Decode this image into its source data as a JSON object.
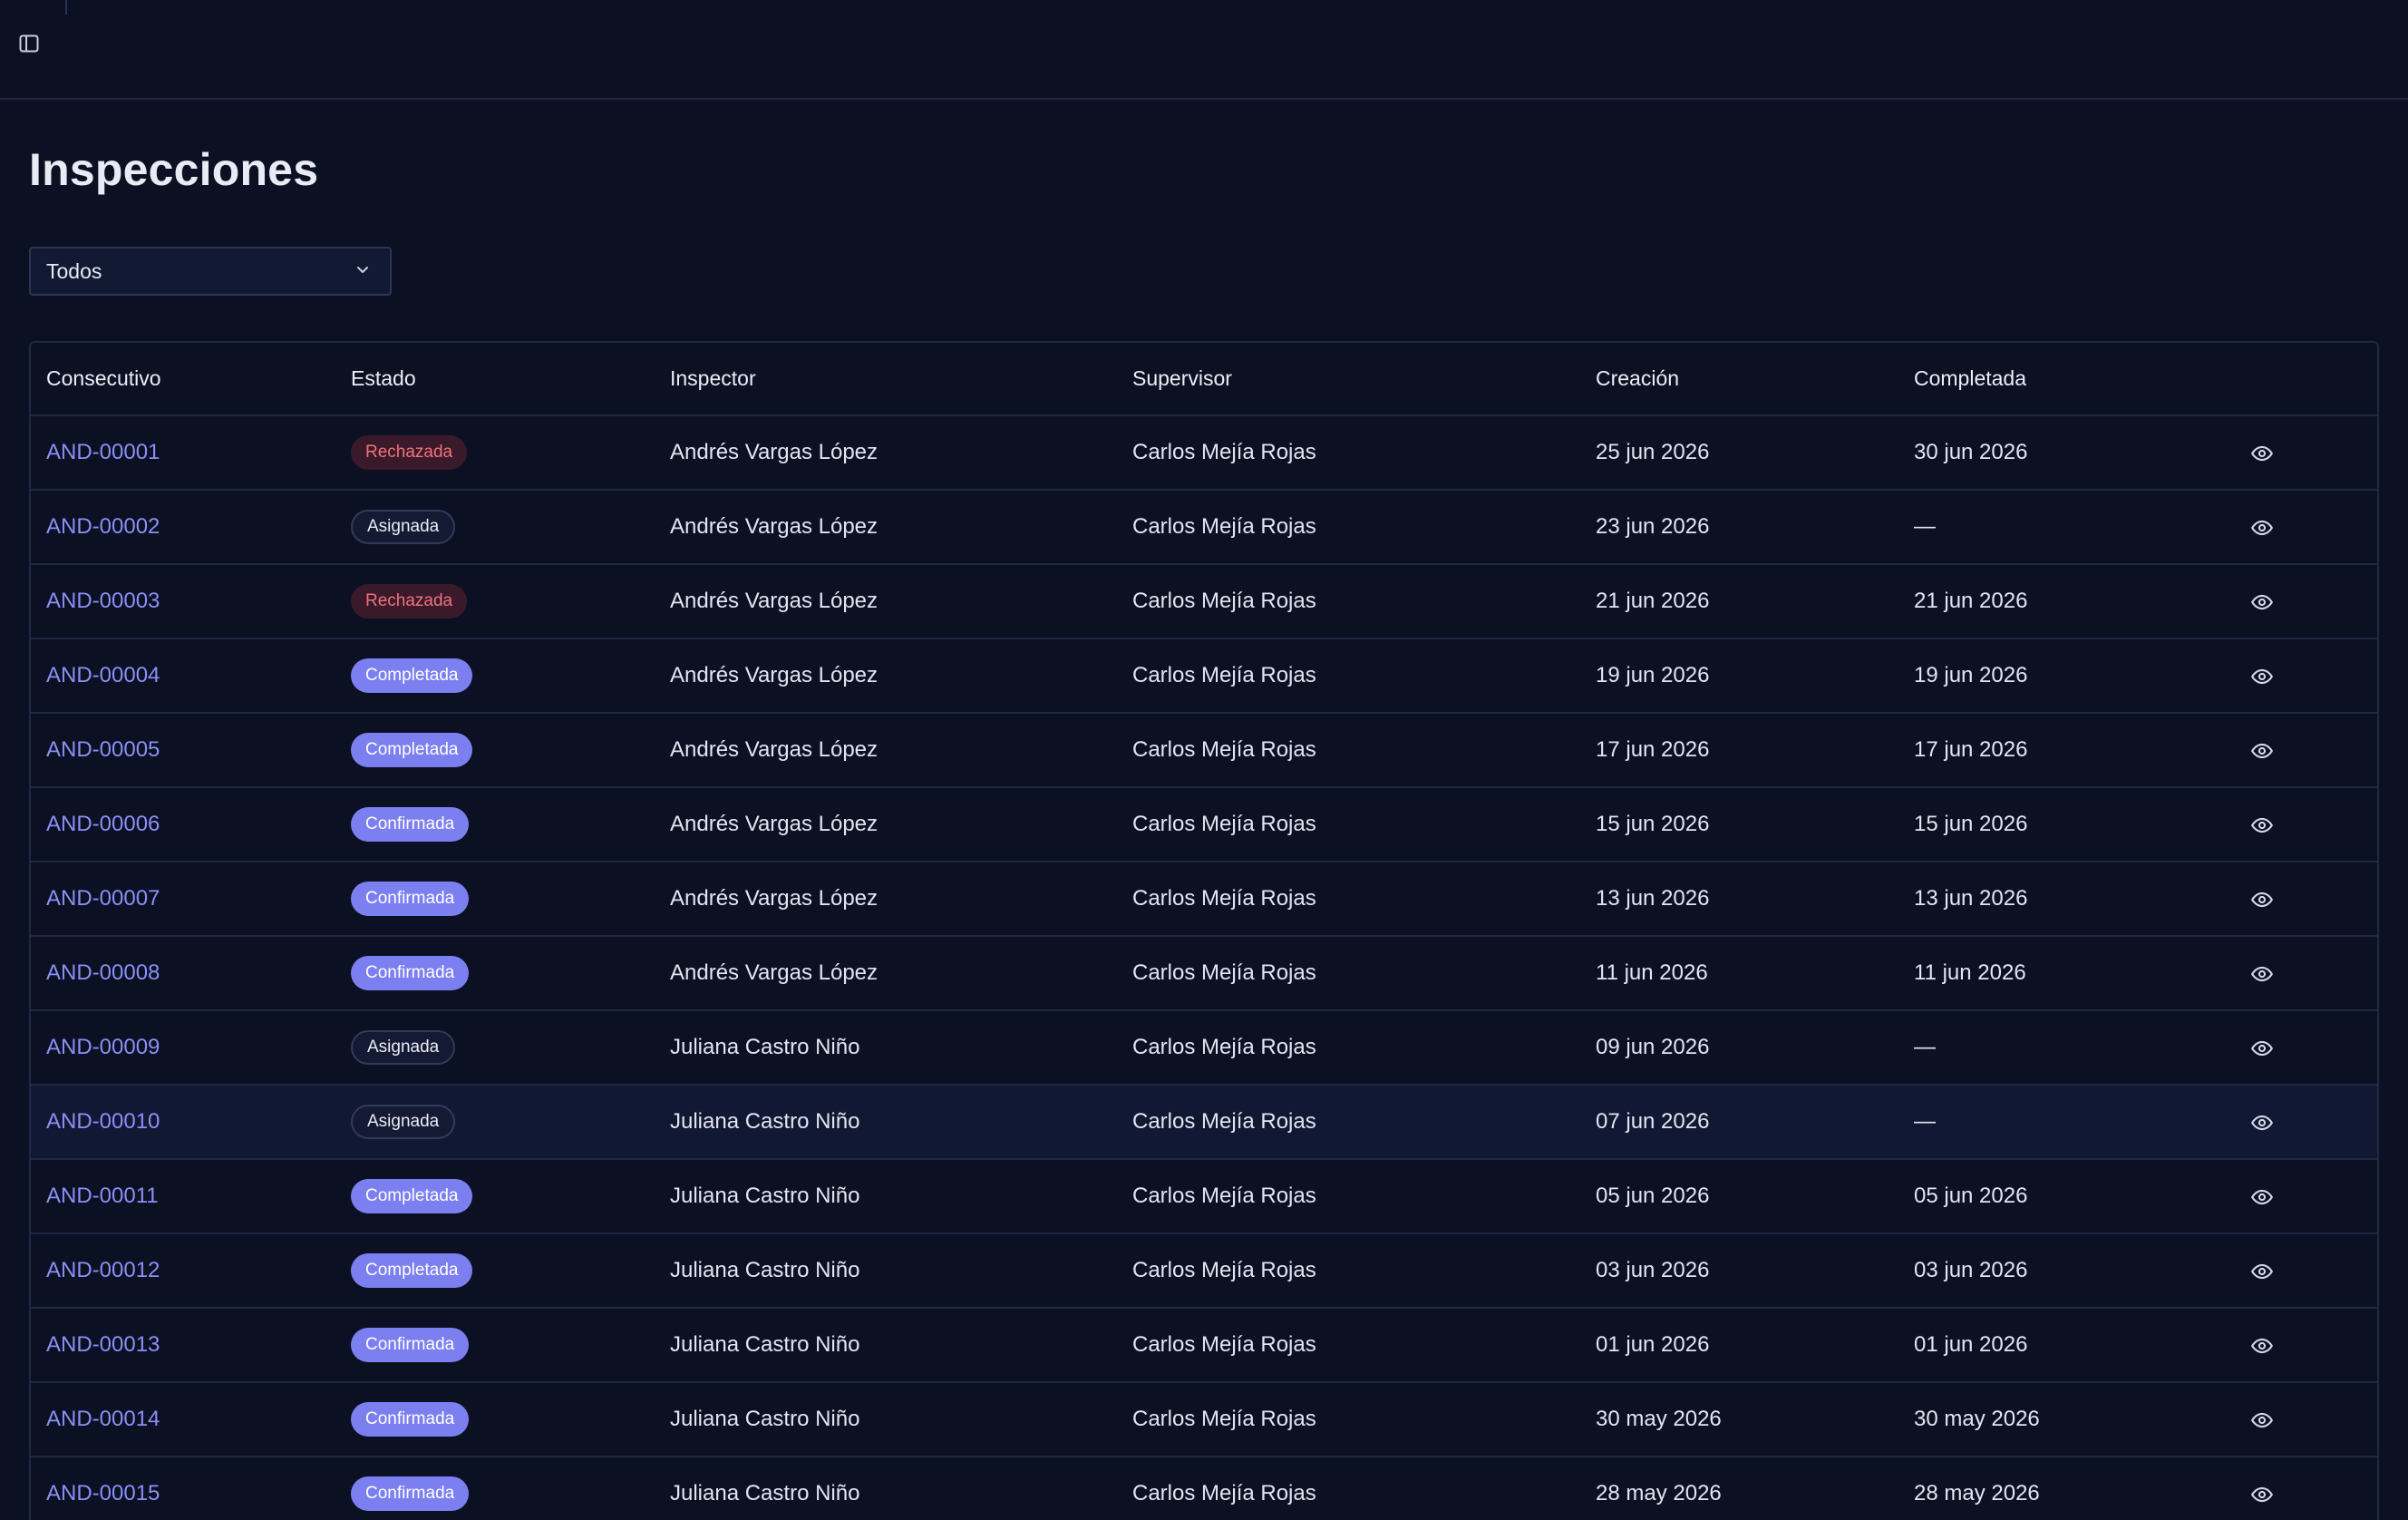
{
  "header": {
    "toggle_icon": "sidebar-toggle-icon"
  },
  "page": {
    "title": "Inspecciones"
  },
  "filter": {
    "selected": "Todos",
    "icon": "chevron-down-icon"
  },
  "table": {
    "columns": [
      "Consecutivo",
      "Estado",
      "Inspector",
      "Supervisor",
      "Creación",
      "Completada"
    ],
    "action_icon": "eye-icon",
    "rows": [
      {
        "code": "AND-00001",
        "status": "Rechazada",
        "status_key": "rechazada",
        "inspector": "Andrés Vargas López",
        "supervisor": "Carlos Mejía Rojas",
        "created": "25 jun 2026",
        "completed": "30 jun 2026"
      },
      {
        "code": "AND-00002",
        "status": "Asignada",
        "status_key": "asignada",
        "inspector": "Andrés Vargas López",
        "supervisor": "Carlos Mejía Rojas",
        "created": "23 jun 2026",
        "completed": "—"
      },
      {
        "code": "AND-00003",
        "status": "Rechazada",
        "status_key": "rechazada",
        "inspector": "Andrés Vargas López",
        "supervisor": "Carlos Mejía Rojas",
        "created": "21 jun 2026",
        "completed": "21 jun 2026"
      },
      {
        "code": "AND-00004",
        "status": "Completada",
        "status_key": "completada",
        "inspector": "Andrés Vargas López",
        "supervisor": "Carlos Mejía Rojas",
        "created": "19 jun 2026",
        "completed": "19 jun 2026"
      },
      {
        "code": "AND-00005",
        "status": "Completada",
        "status_key": "completada",
        "inspector": "Andrés Vargas López",
        "supervisor": "Carlos Mejía Rojas",
        "created": "17 jun 2026",
        "completed": "17 jun 2026"
      },
      {
        "code": "AND-00006",
        "status": "Confirmada",
        "status_key": "confirmada",
        "inspector": "Andrés Vargas López",
        "supervisor": "Carlos Mejía Rojas",
        "created": "15 jun 2026",
        "completed": "15 jun 2026"
      },
      {
        "code": "AND-00007",
        "status": "Confirmada",
        "status_key": "confirmada",
        "inspector": "Andrés Vargas López",
        "supervisor": "Carlos Mejía Rojas",
        "created": "13 jun 2026",
        "completed": "13 jun 2026"
      },
      {
        "code": "AND-00008",
        "status": "Confirmada",
        "status_key": "confirmada",
        "inspector": "Andrés Vargas López",
        "supervisor": "Carlos Mejía Rojas",
        "created": "11 jun 2026",
        "completed": "11 jun 2026"
      },
      {
        "code": "AND-00009",
        "status": "Asignada",
        "status_key": "asignada",
        "inspector": "Juliana Castro Niño",
        "supervisor": "Carlos Mejía Rojas",
        "created": "09 jun 2026",
        "completed": "—"
      },
      {
        "code": "AND-00010",
        "status": "Asignada",
        "status_key": "asignada",
        "inspector": "Juliana Castro Niño",
        "supervisor": "Carlos Mejía Rojas",
        "created": "07 jun 2026",
        "completed": "—"
      },
      {
        "code": "AND-00011",
        "status": "Completada",
        "status_key": "completada",
        "inspector": "Juliana Castro Niño",
        "supervisor": "Carlos Mejía Rojas",
        "created": "05 jun 2026",
        "completed": "05 jun 2026"
      },
      {
        "code": "AND-00012",
        "status": "Completada",
        "status_key": "completada",
        "inspector": "Juliana Castro Niño",
        "supervisor": "Carlos Mejía Rojas",
        "created": "03 jun 2026",
        "completed": "03 jun 2026"
      },
      {
        "code": "AND-00013",
        "status": "Confirmada",
        "status_key": "confirmada",
        "inspector": "Juliana Castro Niño",
        "supervisor": "Carlos Mejía Rojas",
        "created": "01 jun 2026",
        "completed": "01 jun 2026"
      },
      {
        "code": "AND-00014",
        "status": "Confirmada",
        "status_key": "confirmada",
        "inspector": "Juliana Castro Niño",
        "supervisor": "Carlos Mejía Rojas",
        "created": "30 may 2026",
        "completed": "30 may 2026"
      },
      {
        "code": "AND-00015",
        "status": "Confirmada",
        "status_key": "confirmada",
        "inspector": "Juliana Castro Niño",
        "supervisor": "Carlos Mejía Rojas",
        "created": "28 may 2026",
        "completed": "28 may 2026"
      }
    ]
  },
  "colors": {
    "background": "#0b1023",
    "link": "#8b8ff5",
    "badge_primary": "#7c7ff0",
    "badge_danger_text": "#f0727a"
  }
}
